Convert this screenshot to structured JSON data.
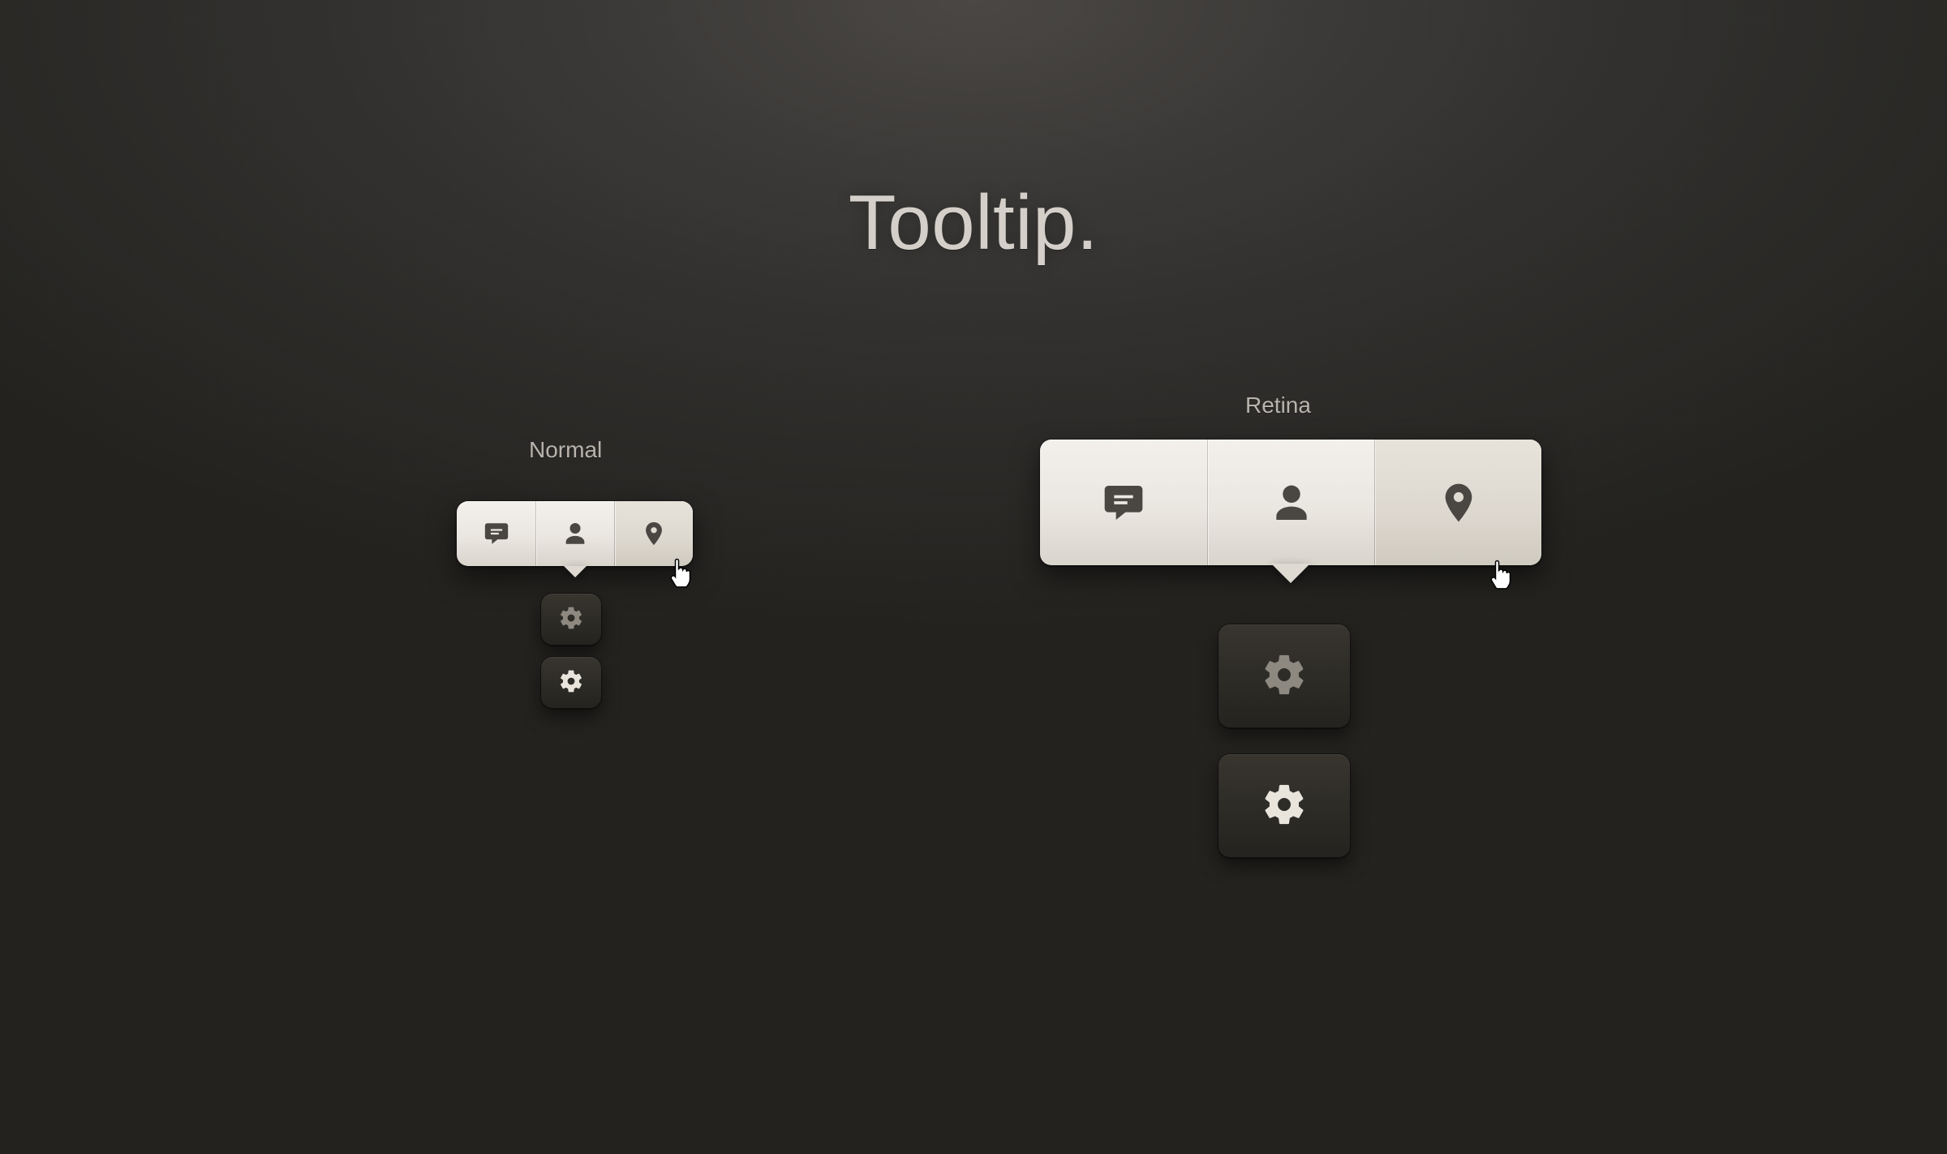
{
  "title": "Tooltip.",
  "groups": {
    "normal": {
      "label": "Normal"
    },
    "retina": {
      "label": "Retina"
    }
  },
  "tooltip_actions": {
    "comment": "comment-icon",
    "user": "user-icon",
    "location": "location-icon"
  },
  "colors": {
    "background": "#2e2c29",
    "tooltip_bg": "#ece8e1",
    "tooltip_icon": "#4a4743",
    "cog_bg": "#2c2a25",
    "cog_icon_light": "#e9e5dd",
    "cog_icon_dim": "#8d8880",
    "title_color": "#d4cfc8"
  }
}
